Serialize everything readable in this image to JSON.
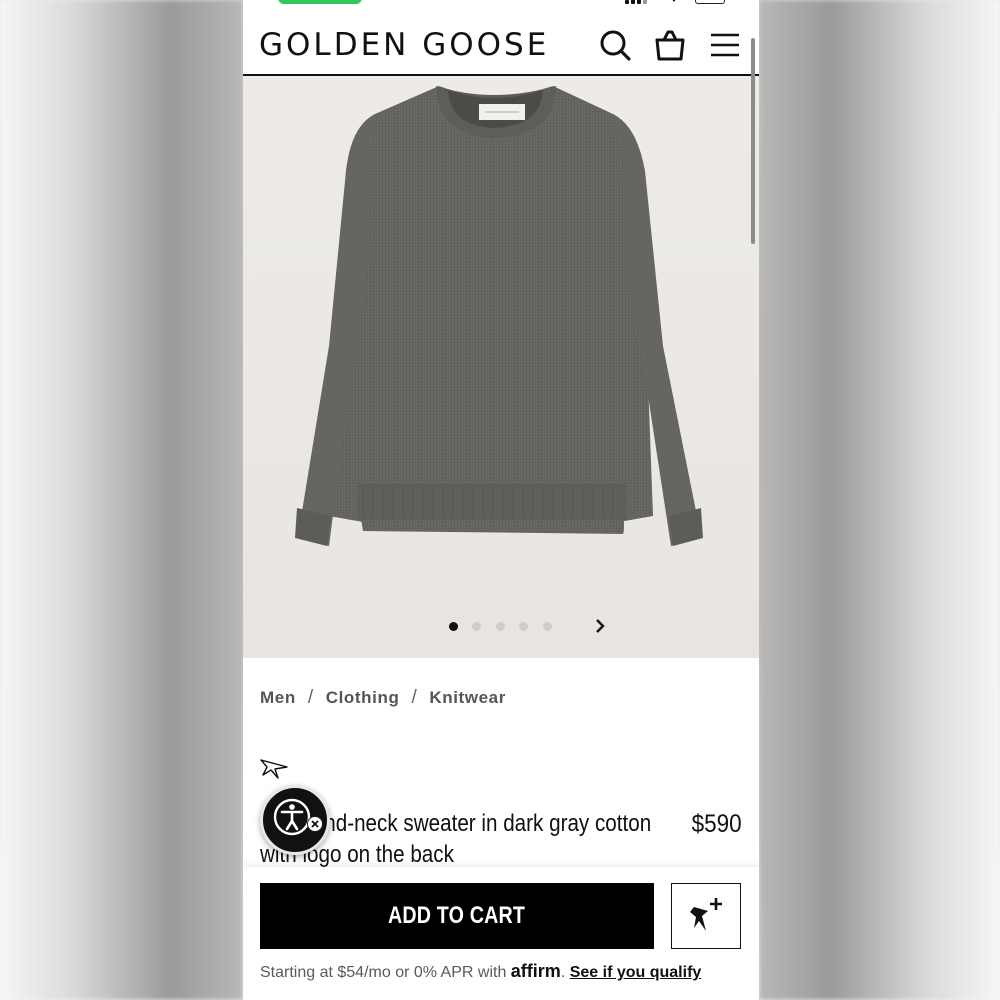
{
  "brand": {
    "logo_text": "GOLDEN GOOSE"
  },
  "header": {
    "icons": [
      "search-icon",
      "shopping-bag-icon",
      "hamburger-menu-icon"
    ]
  },
  "gallery": {
    "total_images": 5,
    "active_index": 0,
    "product_color": "#6b6b66",
    "background_color": "#ece9e5"
  },
  "breadcrumb": [
    "Men",
    "Clothing",
    "Knitwear"
  ],
  "product": {
    "title": "Men's round-neck sweater in dark gray cotton with logo on the back",
    "title_visible_start": "ound-neck sweater in dark gray cotton",
    "title_line2": "with logo on the back",
    "price": "$590"
  },
  "actions": {
    "add_to_cart_label": "ADD TO CART"
  },
  "financing": {
    "prefix": "Starting at $54/mo or 0% APR with ",
    "provider": "affirm",
    "suffix": ". ",
    "link_text": "See if you qualify"
  },
  "colors": {
    "primary": "#000000",
    "status_green": "#34c759"
  }
}
